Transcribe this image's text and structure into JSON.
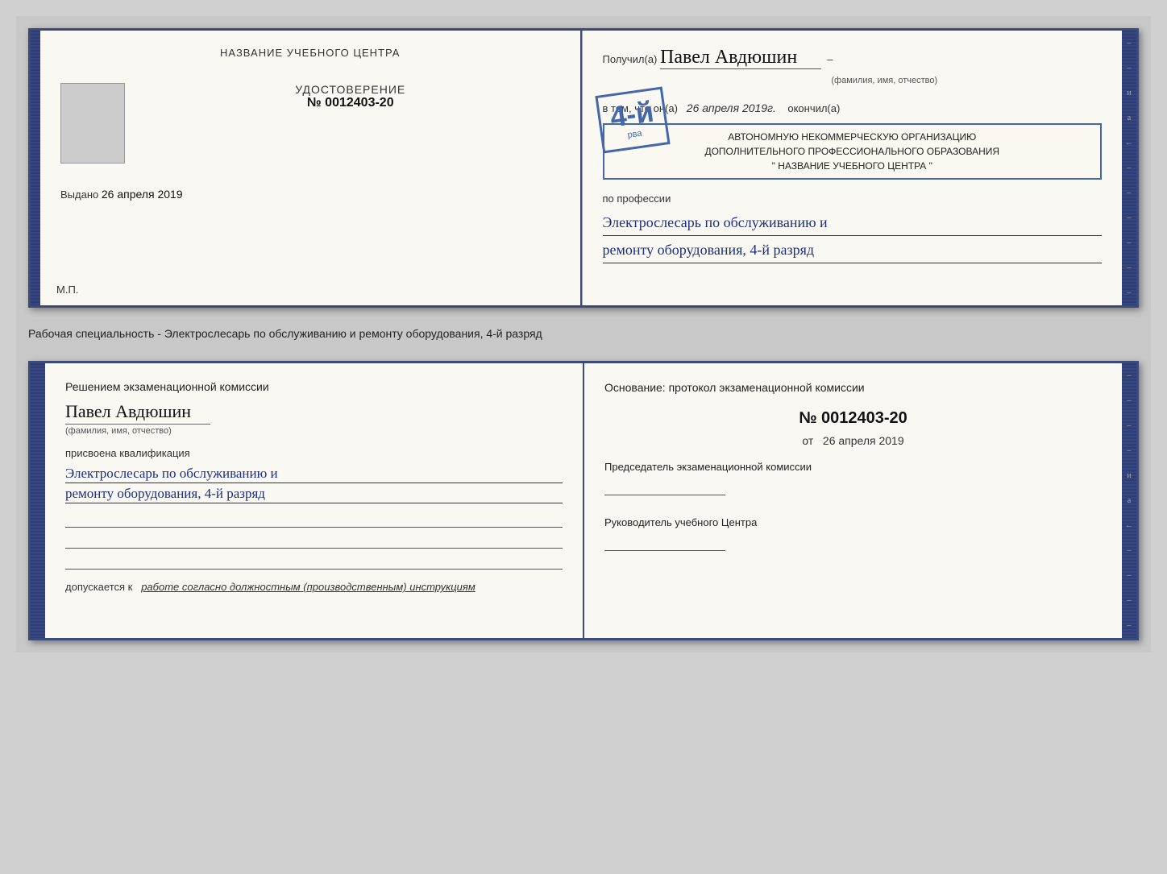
{
  "top_booklet": {
    "left": {
      "title": "НАЗВАНИЕ УЧЕБНОГО ЦЕНТРА",
      "cert_label": "УДОСТОВЕРЕНИЕ",
      "cert_number": "№ 0012403-20",
      "issued_label": "Выдано",
      "issued_date": "26 апреля 2019",
      "mp_label": "М.П."
    },
    "right": {
      "received_label": "Получил(а)",
      "recipient_name": "Павел Авдюшин",
      "name_sub": "(фамилия, имя, отчество)",
      "in_that": "в том, что он(а)",
      "date_italic": "26 апреля 2019г.",
      "finished_label": "окончил(а)",
      "org_line1": "АВТОНОМНУЮ НЕКОММЕРЧЕСКУЮ ОРГАНИЗАЦИЮ",
      "org_line2": "ДОПОЛНИТЕЛЬНОГО ПРОФЕССИОНАЛЬНОГО ОБРАЗОВАНИЯ",
      "org_name": "\" НАЗВАНИЕ УЧЕБНОГО ЦЕНТРА \"",
      "profession_label": "по профессии",
      "profession_line1": "Электрослесарь по обслуживанию и",
      "profession_line2": "ремонту оборудования, 4-й разряд",
      "stamp_grade": "4-й",
      "stamp_line1": "рва",
      "stamp_rect_visible": true
    }
  },
  "separator": {
    "text": "Рабочая специальность - Электрослесарь по обслуживанию и ремонту оборудования, 4-й разряд"
  },
  "bottom_booklet": {
    "left": {
      "decision_title": "Решением экзаменационной комиссии",
      "person_name": "Павел Авдюшин",
      "name_sub": "(фамилия, имя, отчество)",
      "qualification_label": "присвоена квалификация",
      "qualification_line1": "Электрослесарь по обслуживанию и",
      "qualification_line2": "ремонту оборудования, 4-й разряд",
      "допускается_prefix": "допускается к",
      "допускается_text": "работе согласно должностным (производственным) инструкциям"
    },
    "right": {
      "basis_label": "Основание: протокол экзаменационной комиссии",
      "doc_number": "№ 0012403-20",
      "date_from_prefix": "от",
      "date_from": "26 апреля 2019",
      "chairman_label": "Председатель экзаменационной комиссии",
      "director_label": "Руководитель учебного Центра"
    }
  },
  "icons": {
    "и": "и",
    "а": "а",
    "arrow_left": "←"
  }
}
